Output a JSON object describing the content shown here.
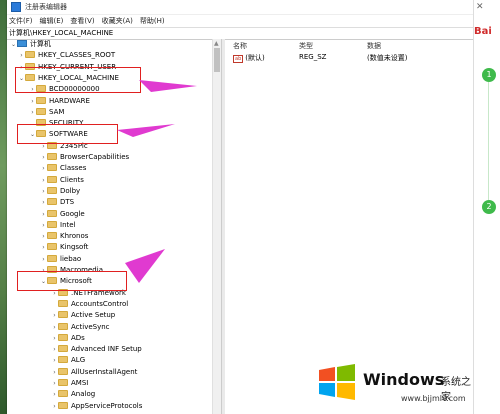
{
  "window": {
    "title": "注册表编辑器"
  },
  "menu": [
    "文件(F)",
    "编辑(E)",
    "查看(V)",
    "收藏夹(A)",
    "帮助(H)"
  ],
  "address": "计算机\\HKEY_LOCAL_MACHINE",
  "tree": [
    {
      "label": "计算机",
      "level": 0,
      "chev": "v",
      "icon": "pc"
    },
    {
      "label": "HKEY_CLASSES_ROOT",
      "level": 1,
      "chev": ">"
    },
    {
      "label": "HKEY_CURRENT_USER",
      "level": 1,
      "chev": ">"
    },
    {
      "label": "HKEY_LOCAL_MACHINE",
      "level": 1,
      "chev": "v"
    },
    {
      "label": "BCD00000000",
      "level": 2,
      "chev": ">"
    },
    {
      "label": "HARDWARE",
      "level": 2,
      "chev": ">"
    },
    {
      "label": "SAM",
      "level": 2,
      "chev": ">"
    },
    {
      "label": "SECURITY",
      "level": 2,
      "chev": ""
    },
    {
      "label": "SOFTWARE",
      "level": 2,
      "chev": "v"
    },
    {
      "label": "2345Pic",
      "level": 3,
      "chev": ">"
    },
    {
      "label": "BrowserCapabilities",
      "level": 3,
      "chev": ">"
    },
    {
      "label": "Classes",
      "level": 3,
      "chev": ">"
    },
    {
      "label": "Clients",
      "level": 3,
      "chev": ">"
    },
    {
      "label": "Dolby",
      "level": 3,
      "chev": ">"
    },
    {
      "label": "DTS",
      "level": 3,
      "chev": ">"
    },
    {
      "label": "Google",
      "level": 3,
      "chev": ">"
    },
    {
      "label": "Intel",
      "level": 3,
      "chev": ">"
    },
    {
      "label": "Khronos",
      "level": 3,
      "chev": ">"
    },
    {
      "label": "Kingsoft",
      "level": 3,
      "chev": ">"
    },
    {
      "label": "liebao",
      "level": 3,
      "chev": ">"
    },
    {
      "label": "Macromedia",
      "level": 3,
      "chev": ">"
    },
    {
      "label": "Microsoft",
      "level": 3,
      "chev": "v"
    },
    {
      "label": ".NETFramework",
      "level": 4,
      "chev": ">"
    },
    {
      "label": "AccountsControl",
      "level": 4,
      "chev": ""
    },
    {
      "label": "Active Setup",
      "level": 4,
      "chev": ">"
    },
    {
      "label": "ActiveSync",
      "level": 4,
      "chev": ">"
    },
    {
      "label": "ADs",
      "level": 4,
      "chev": ">"
    },
    {
      "label": "Advanced INF Setup",
      "level": 4,
      "chev": ">"
    },
    {
      "label": "ALG",
      "level": 4,
      "chev": ">"
    },
    {
      "label": "AllUserInstallAgent",
      "level": 4,
      "chev": ">"
    },
    {
      "label": "AMSI",
      "level": 4,
      "chev": ">"
    },
    {
      "label": "Analog",
      "level": 4,
      "chev": ">"
    },
    {
      "label": "AppServiceProtocols",
      "level": 4,
      "chev": ">"
    }
  ],
  "columns": {
    "name": "名称",
    "type": "类型",
    "data": "数据"
  },
  "values": [
    {
      "name": "(默认)",
      "type": "REG_SZ",
      "data": "(数值未设置)",
      "icon": "ab"
    }
  ],
  "watermark": {
    "brand": "Windows",
    "cn": "系统之家",
    "site": "www.bjjmlv.com"
  },
  "side": {
    "brand": "Bai",
    "steps": [
      "1",
      "2"
    ]
  },
  "colors": {
    "highlight": "#e02020",
    "arrow": "#e03ad0",
    "folder": "#e9c46a",
    "step": "#3fba4b"
  }
}
